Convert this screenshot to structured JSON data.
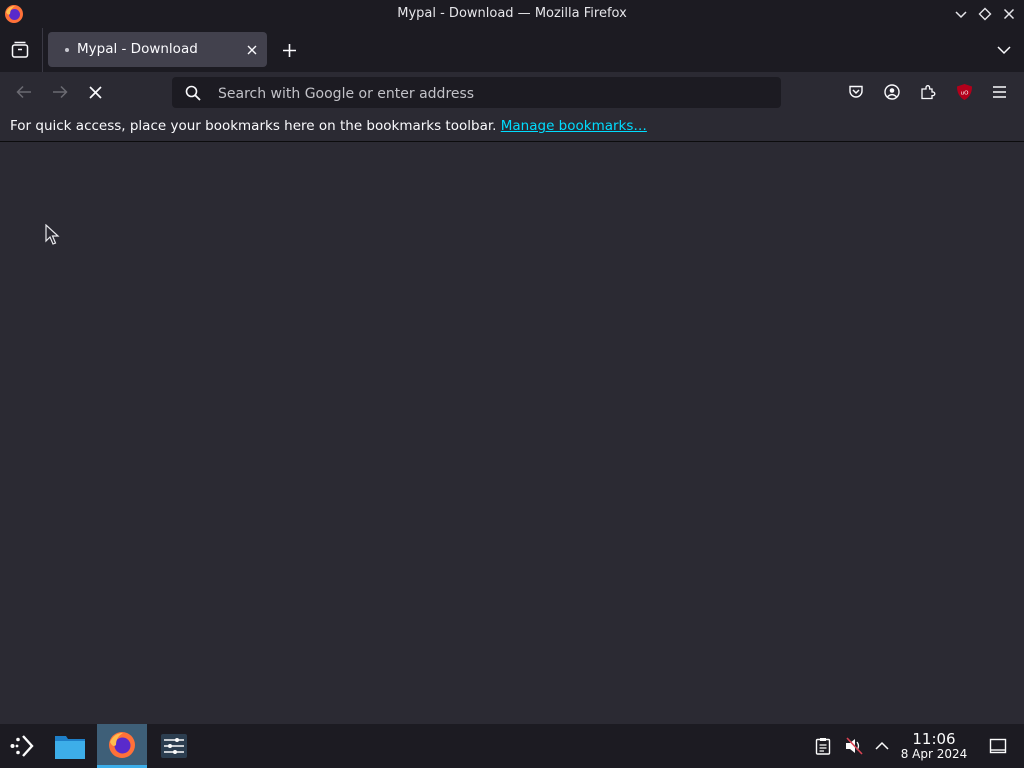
{
  "window": {
    "title": "Mypal - Download — Mozilla Firefox"
  },
  "tabs": [
    {
      "label": "Mypal - Download",
      "active": true
    }
  ],
  "urlbar": {
    "placeholder": "Search with Google or enter address",
    "value": ""
  },
  "bookmarks_bar": {
    "message": "For quick access, place your bookmarks here on the bookmarks toolbar.",
    "link_label": "Manage bookmarks…"
  },
  "taskbar": {
    "time": "11:06",
    "date": "8 Apr 2024"
  },
  "colors": {
    "accent": "#3daee9",
    "link": "#00ddff",
    "ublock_red": "#b3001b"
  }
}
